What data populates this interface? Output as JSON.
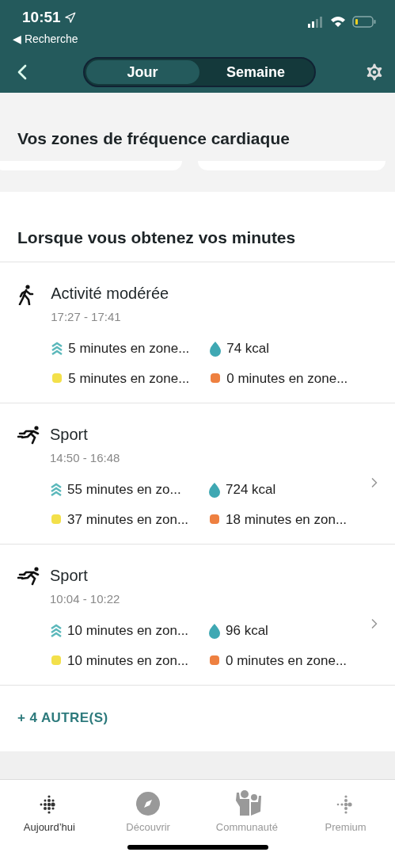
{
  "status_bar": {
    "time": "10:51",
    "back_label": "◀ Recherche"
  },
  "tabs": [
    {
      "label": "Jour",
      "selected": true
    },
    {
      "label": "Semaine",
      "selected": false
    }
  ],
  "heart_zones": {
    "title": "Vos zones de fréquence cardiaque"
  },
  "minutes": {
    "title": "Lorsque vous obtenez vos minutes",
    "activities": [
      {
        "kind": "walk",
        "name": "Activité modérée",
        "time": "17:27 - 17:41",
        "zone_minutes": "5 minutes en zone...",
        "calories": "74 kcal",
        "fat_burn": "5 minutes en zone...",
        "cardio": "0 minutes en zone...",
        "has_details": false
      },
      {
        "kind": "run",
        "name": "Sport",
        "time": "14:50 - 16:48",
        "zone_minutes": "55 minutes en zo...",
        "calories": "724 kcal",
        "fat_burn": "37 minutes en zon...",
        "cardio": "18 minutes en zon...",
        "has_details": true
      },
      {
        "kind": "run",
        "name": "Sport",
        "time": "10:04 - 10:22",
        "zone_minutes": "10 minutes en zon...",
        "calories": "96 kcal",
        "fat_burn": "10 minutes en zon...",
        "cardio": "0 minutes en zone...",
        "has_details": true
      }
    ],
    "more": "+ 4 AUTRE(S)"
  },
  "bottom_nav": [
    {
      "label": "Aujourd’hui",
      "selected": true,
      "kind": "today"
    },
    {
      "label": "Découvrir",
      "selected": false,
      "kind": "discover"
    },
    {
      "label": "Communauté",
      "selected": false,
      "kind": "community"
    },
    {
      "label": "Premium",
      "selected": false,
      "kind": "premium"
    }
  ]
}
